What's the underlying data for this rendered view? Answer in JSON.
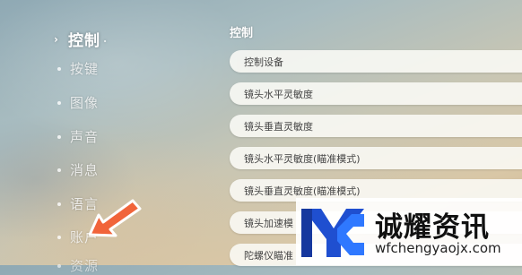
{
  "sidebar": {
    "items": [
      {
        "label": "控制",
        "active": true
      },
      {
        "label": "按键"
      },
      {
        "label": "图像"
      },
      {
        "label": "声音"
      },
      {
        "label": "消息"
      },
      {
        "label": "语言"
      },
      {
        "label": "账户"
      },
      {
        "label": "资源"
      }
    ]
  },
  "panel": {
    "title": "控制",
    "rows": [
      {
        "label": "控制设备"
      },
      {
        "label": "镜头水平灵敏度"
      },
      {
        "label": "镜头垂直灵敏度"
      },
      {
        "label": "镜头水平灵敏度(瞄准模式)"
      },
      {
        "label": "镜头垂直灵敏度(瞄准模式)"
      },
      {
        "label": "镜头加速模"
      },
      {
        "label": "陀螺仪瞄准"
      }
    ]
  },
  "watermark": {
    "brand": "诚耀资讯",
    "url": "wfchengyaojx.com"
  },
  "colors": {
    "arrow": "#f1643a",
    "logo_blue": "#1f4fd0"
  },
  "icons": {
    "pointer": "arrow-pointer-icon",
    "logo": "brand-logo-icon",
    "chevron": "chevron-right-icon"
  }
}
